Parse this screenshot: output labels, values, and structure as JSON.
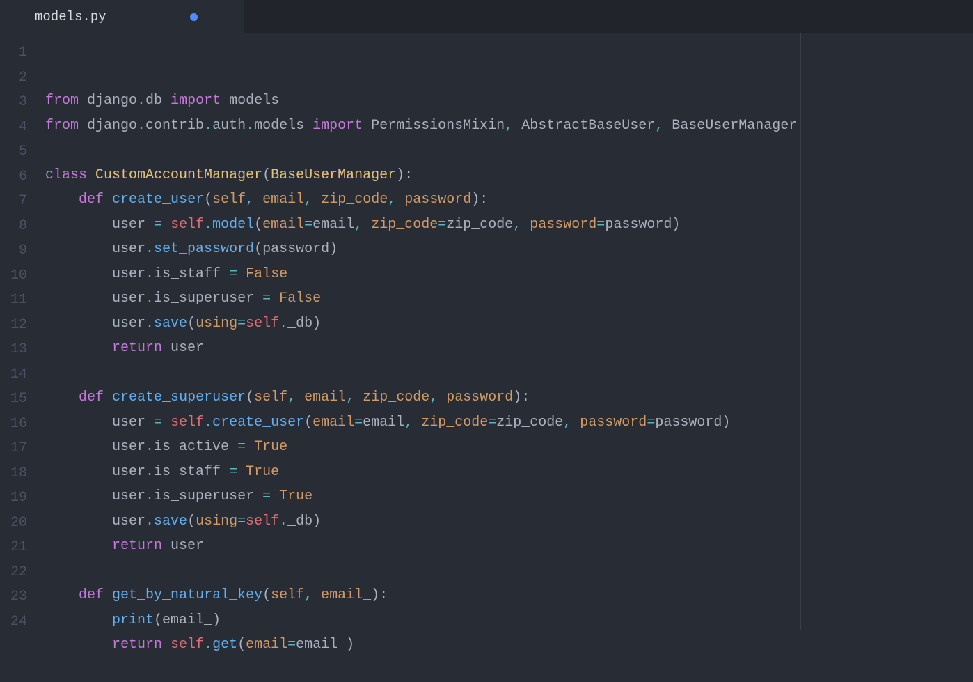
{
  "tab": {
    "filename": "models.py",
    "dirty": true
  },
  "lines": [
    {
      "num": "1",
      "tokens": [
        [
          "kw",
          "from"
        ],
        [
          "plain",
          " django"
        ],
        [
          "op",
          "."
        ],
        [
          "plain",
          "db "
        ],
        [
          "kw",
          "import"
        ],
        [
          "plain",
          " models"
        ]
      ]
    },
    {
      "num": "2",
      "tokens": [
        [
          "kw",
          "from"
        ],
        [
          "plain",
          " django"
        ],
        [
          "op",
          "."
        ],
        [
          "plain",
          "contrib"
        ],
        [
          "op",
          "."
        ],
        [
          "plain",
          "auth"
        ],
        [
          "op",
          "."
        ],
        [
          "plain",
          "models "
        ],
        [
          "kw",
          "import"
        ],
        [
          "plain",
          " PermissionsMixin"
        ],
        [
          "op",
          ","
        ],
        [
          "plain",
          " AbstractBaseUser"
        ],
        [
          "op",
          ","
        ],
        [
          "plain",
          " BaseUserManager"
        ]
      ]
    },
    {
      "num": "3",
      "tokens": []
    },
    {
      "num": "4",
      "tokens": [
        [
          "kw",
          "class"
        ],
        [
          "plain",
          " "
        ],
        [
          "cls",
          "CustomAccountManager"
        ],
        [
          "plain",
          "("
        ],
        [
          "cls",
          "BaseUserManager"
        ],
        [
          "plain",
          "):"
        ]
      ]
    },
    {
      "num": "5",
      "tokens": [
        [
          "plain",
          "    "
        ],
        [
          "kw",
          "def"
        ],
        [
          "plain",
          " "
        ],
        [
          "fn",
          "create_user"
        ],
        [
          "plain",
          "("
        ],
        [
          "param",
          "self"
        ],
        [
          "op",
          ","
        ],
        [
          "plain",
          " "
        ],
        [
          "param",
          "email"
        ],
        [
          "op",
          ","
        ],
        [
          "plain",
          " "
        ],
        [
          "param",
          "zip_code"
        ],
        [
          "op",
          ","
        ],
        [
          "plain",
          " "
        ],
        [
          "param",
          "password"
        ],
        [
          "plain",
          "):"
        ]
      ]
    },
    {
      "num": "6",
      "tokens": [
        [
          "plain",
          "        user "
        ],
        [
          "op",
          "="
        ],
        [
          "plain",
          " "
        ],
        [
          "self",
          "self"
        ],
        [
          "op",
          "."
        ],
        [
          "fn",
          "model"
        ],
        [
          "plain",
          "("
        ],
        [
          "param",
          "email"
        ],
        [
          "op",
          "="
        ],
        [
          "plain",
          "email"
        ],
        [
          "op",
          ","
        ],
        [
          "plain",
          " "
        ],
        [
          "param",
          "zip_code"
        ],
        [
          "op",
          "="
        ],
        [
          "plain",
          "zip_code"
        ],
        [
          "op",
          ","
        ],
        [
          "plain",
          " "
        ],
        [
          "param",
          "password"
        ],
        [
          "op",
          "="
        ],
        [
          "plain",
          "password)"
        ]
      ]
    },
    {
      "num": "7",
      "tokens": [
        [
          "plain",
          "        user"
        ],
        [
          "op",
          "."
        ],
        [
          "fn",
          "set_password"
        ],
        [
          "plain",
          "(password)"
        ]
      ]
    },
    {
      "num": "8",
      "tokens": [
        [
          "plain",
          "        user"
        ],
        [
          "op",
          "."
        ],
        [
          "plain",
          "is_staff "
        ],
        [
          "op",
          "="
        ],
        [
          "plain",
          " "
        ],
        [
          "const",
          "False"
        ]
      ]
    },
    {
      "num": "9",
      "tokens": [
        [
          "plain",
          "        user"
        ],
        [
          "op",
          "."
        ],
        [
          "plain",
          "is_superuser "
        ],
        [
          "op",
          "="
        ],
        [
          "plain",
          " "
        ],
        [
          "const",
          "False"
        ]
      ]
    },
    {
      "num": "10",
      "tokens": [
        [
          "plain",
          "        user"
        ],
        [
          "op",
          "."
        ],
        [
          "fn",
          "save"
        ],
        [
          "plain",
          "("
        ],
        [
          "param",
          "using"
        ],
        [
          "op",
          "="
        ],
        [
          "self",
          "self"
        ],
        [
          "op",
          "."
        ],
        [
          "plain",
          "_db)"
        ]
      ]
    },
    {
      "num": "11",
      "tokens": [
        [
          "plain",
          "        "
        ],
        [
          "kw",
          "return"
        ],
        [
          "plain",
          " user"
        ]
      ]
    },
    {
      "num": "12",
      "tokens": []
    },
    {
      "num": "13",
      "tokens": [
        [
          "plain",
          "    "
        ],
        [
          "kw",
          "def"
        ],
        [
          "plain",
          " "
        ],
        [
          "fn",
          "create_superuser"
        ],
        [
          "plain",
          "("
        ],
        [
          "param",
          "self"
        ],
        [
          "op",
          ","
        ],
        [
          "plain",
          " "
        ],
        [
          "param",
          "email"
        ],
        [
          "op",
          ","
        ],
        [
          "plain",
          " "
        ],
        [
          "param",
          "zip_code"
        ],
        [
          "op",
          ","
        ],
        [
          "plain",
          " "
        ],
        [
          "param",
          "password"
        ],
        [
          "plain",
          "):"
        ]
      ]
    },
    {
      "num": "14",
      "tokens": [
        [
          "plain",
          "        user "
        ],
        [
          "op",
          "="
        ],
        [
          "plain",
          " "
        ],
        [
          "self",
          "self"
        ],
        [
          "op",
          "."
        ],
        [
          "fn",
          "create_user"
        ],
        [
          "plain",
          "("
        ],
        [
          "param",
          "email"
        ],
        [
          "op",
          "="
        ],
        [
          "plain",
          "email"
        ],
        [
          "op",
          ","
        ],
        [
          "plain",
          " "
        ],
        [
          "param",
          "zip_code"
        ],
        [
          "op",
          "="
        ],
        [
          "plain",
          "zip_code"
        ],
        [
          "op",
          ","
        ],
        [
          "plain",
          " "
        ],
        [
          "param",
          "password"
        ],
        [
          "op",
          "="
        ],
        [
          "plain",
          "password)"
        ]
      ]
    },
    {
      "num": "15",
      "tokens": [
        [
          "plain",
          "        user"
        ],
        [
          "op",
          "."
        ],
        [
          "plain",
          "is_active "
        ],
        [
          "op",
          "="
        ],
        [
          "plain",
          " "
        ],
        [
          "const",
          "True"
        ]
      ]
    },
    {
      "num": "16",
      "tokens": [
        [
          "plain",
          "        user"
        ],
        [
          "op",
          "."
        ],
        [
          "plain",
          "is_staff "
        ],
        [
          "op",
          "="
        ],
        [
          "plain",
          " "
        ],
        [
          "const",
          "True"
        ]
      ]
    },
    {
      "num": "17",
      "tokens": [
        [
          "plain",
          "        user"
        ],
        [
          "op",
          "."
        ],
        [
          "plain",
          "is_superuser "
        ],
        [
          "op",
          "="
        ],
        [
          "plain",
          " "
        ],
        [
          "const",
          "True"
        ]
      ]
    },
    {
      "num": "18",
      "tokens": [
        [
          "plain",
          "        user"
        ],
        [
          "op",
          "."
        ],
        [
          "fn",
          "save"
        ],
        [
          "plain",
          "("
        ],
        [
          "param",
          "using"
        ],
        [
          "op",
          "="
        ],
        [
          "self",
          "self"
        ],
        [
          "op",
          "."
        ],
        [
          "plain",
          "_db)"
        ]
      ]
    },
    {
      "num": "19",
      "tokens": [
        [
          "plain",
          "        "
        ],
        [
          "kw",
          "return"
        ],
        [
          "plain",
          " user"
        ]
      ]
    },
    {
      "num": "20",
      "tokens": []
    },
    {
      "num": "21",
      "tokens": [
        [
          "plain",
          "    "
        ],
        [
          "kw",
          "def"
        ],
        [
          "plain",
          " "
        ],
        [
          "fn",
          "get_by_natural_key"
        ],
        [
          "plain",
          "("
        ],
        [
          "param",
          "self"
        ],
        [
          "op",
          ","
        ],
        [
          "plain",
          " "
        ],
        [
          "param",
          "email_"
        ],
        [
          "plain",
          "):"
        ]
      ]
    },
    {
      "num": "22",
      "tokens": [
        [
          "plain",
          "        "
        ],
        [
          "fn",
          "print"
        ],
        [
          "plain",
          "(email_)"
        ]
      ]
    },
    {
      "num": "23",
      "tokens": [
        [
          "plain",
          "        "
        ],
        [
          "kw",
          "return"
        ],
        [
          "plain",
          " "
        ],
        [
          "self",
          "self"
        ],
        [
          "op",
          "."
        ],
        [
          "fn",
          "get"
        ],
        [
          "plain",
          "("
        ],
        [
          "param",
          "email"
        ],
        [
          "op",
          "="
        ],
        [
          "plain",
          "email_)"
        ]
      ]
    },
    {
      "num": "24",
      "tokens": []
    }
  ]
}
